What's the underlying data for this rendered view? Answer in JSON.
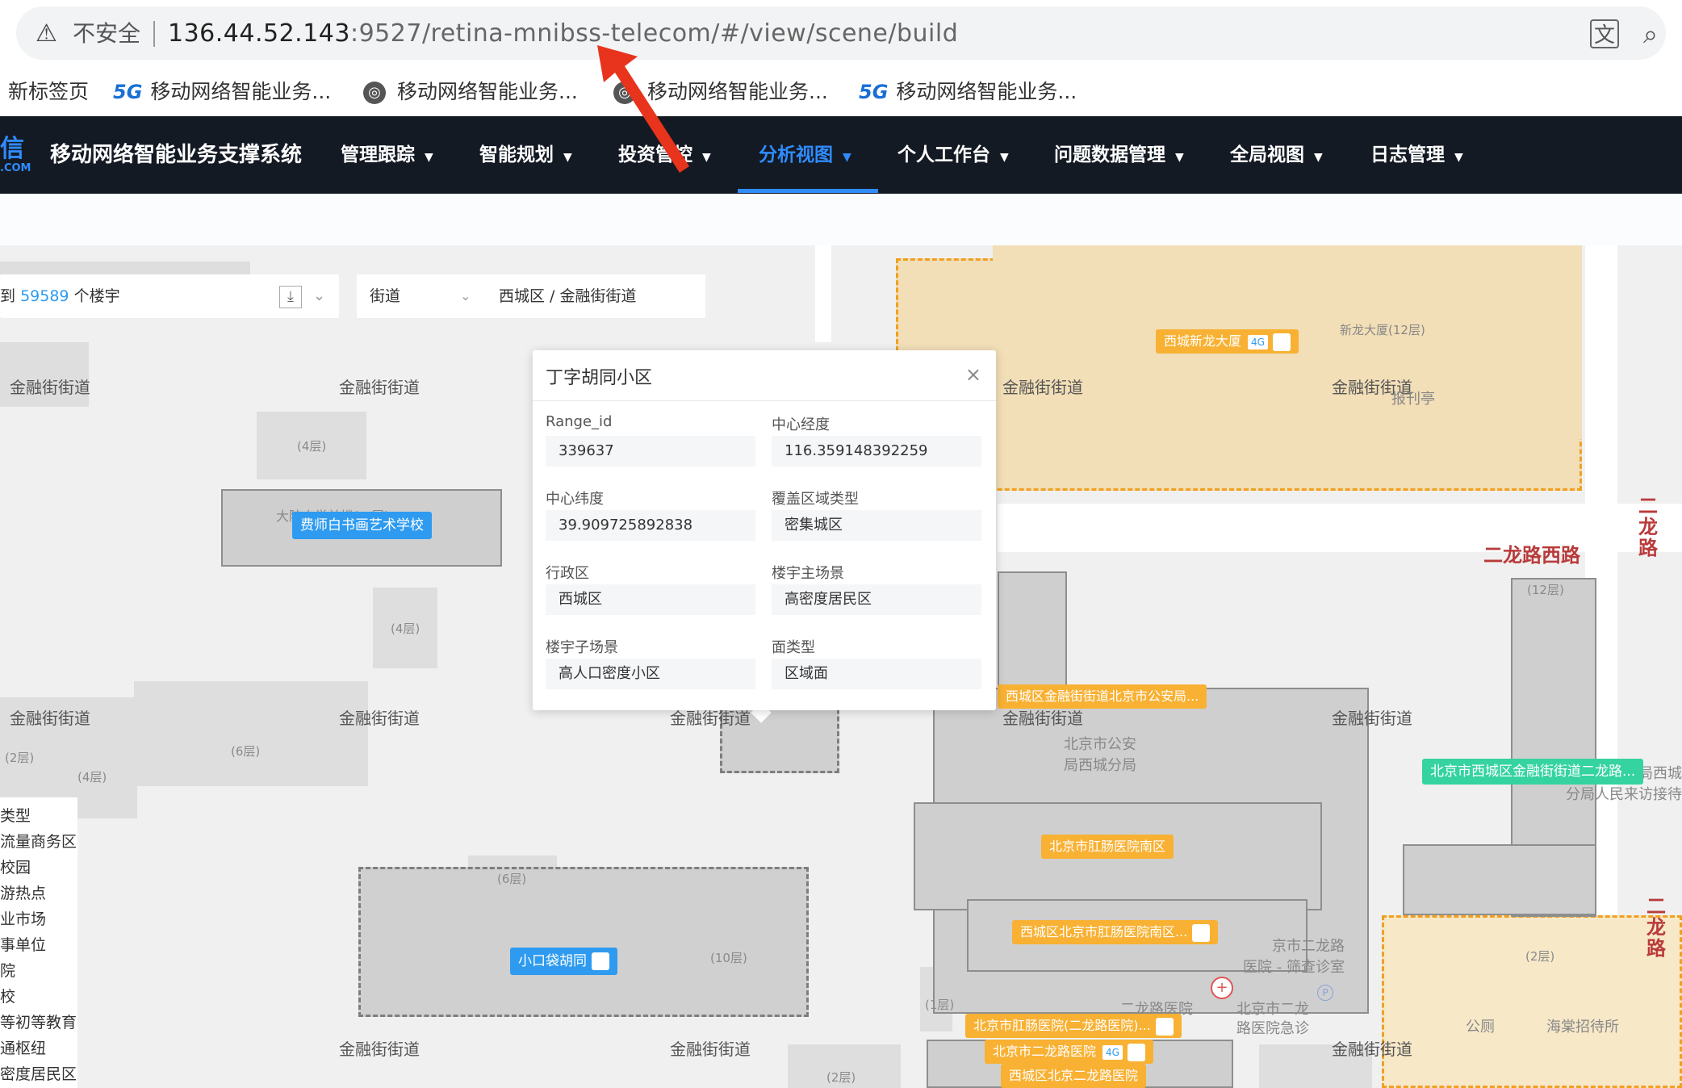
{
  "browser": {
    "security_label": "不安全",
    "url_host": "136.44.52.143",
    "url_rest": ":9527/retina-mnibss-telecom/#/view/scene/build",
    "bookmarks": [
      {
        "label": "新标签页"
      },
      {
        "label": "移动网络智能业务...",
        "icon_text": "5G"
      },
      {
        "label": "移动网络智能业务..."
      },
      {
        "label": "移动网络智能业务..."
      },
      {
        "label": "移动网络智能业务...",
        "icon_text": "5G"
      }
    ]
  },
  "app": {
    "logo_text": "信",
    "logo_sub": ".COM",
    "title": "移动网络智能业务支撑系统",
    "nav": [
      {
        "label": "管理跟踪"
      },
      {
        "label": "智能规划"
      },
      {
        "label": "投资管控"
      },
      {
        "label": "分析视图",
        "active": true
      },
      {
        "label": "个人工作台"
      },
      {
        "label": "问题数据管理"
      },
      {
        "label": "全局视图"
      },
      {
        "label": "日志管理"
      }
    ],
    "accent_color": "#2f8cff"
  },
  "filters": {
    "found_prefix": "到",
    "found_count": "59589",
    "found_suffix": "个楼宇",
    "level": "街道",
    "region_path": "西城区 / 金融街街道"
  },
  "popup": {
    "title": "丁字胡同小区",
    "fields": [
      {
        "label": "Range_id",
        "value": "339637"
      },
      {
        "label": "中心经度",
        "value": "116.359148392259"
      },
      {
        "label": "中心纬度",
        "value": "39.909725892838"
      },
      {
        "label": "覆盖区域类型",
        "value": "密集城区"
      },
      {
        "label": "行政区",
        "value": "西城区"
      },
      {
        "label": "楼宇主场景",
        "value": "高密度居民区"
      },
      {
        "label": "楼宇子场景",
        "value": "高人口密度小区"
      },
      {
        "label": "面类型",
        "value": "区域面"
      }
    ]
  },
  "legend": {
    "items": [
      "类型",
      "流量商务区",
      "校园",
      "游热点",
      "业市场",
      "事单位",
      "院",
      "校",
      "等初等教育",
      "通枢纽",
      "密度居民区"
    ]
  },
  "map": {
    "street_label": "金融街街道",
    "floors": [
      "(4层)",
      "(4层)",
      "(6层)",
      "(2层)",
      "(4层)",
      "(6层)",
      "(10层)",
      "(1层)",
      "(12层)",
      "(2层)",
      "(2层)",
      "(1层)"
    ],
    "roads": {
      "east_west": "二龙路西路",
      "north_south": "二龙路",
      "north_south_2": "二龙路"
    },
    "tags": {
      "blue_1": "费师白书画艺术学校",
      "blue_2": "小口袋胡同",
      "orange_1": "西城新龙大厦",
      "orange_2": "西城区金融街街道北京市公安局...",
      "orange_3": "北京市肛肠医院南区",
      "orange_4": "西城区北京市肛肠医院南区...",
      "orange_5": "北京市肛肠医院(二龙路医院)...",
      "orange_6": "北京市二龙路医院",
      "orange_7": "西城区北京二龙路医院",
      "green_1": "北京市西城区金融街街道二龙路...",
      "chip_4g": "4G"
    },
    "pois": {
      "p1": "新龙大厦(12层)",
      "p2": "报刊亭",
      "p3": "北京市公安",
      "p4": "局西城分局",
      "p5": "京市二龙路",
      "p6": "医院 - 筛查诊室",
      "p7": "二龙路医院",
      "p8": "北京市二龙",
      "p9": "路医院急诊",
      "p10": "公厕",
      "p11": "海棠招待所",
      "p12": "局西城",
      "p13": "分局人民来访接待",
      "p14": "大陆小学前楼(一层)"
    }
  }
}
